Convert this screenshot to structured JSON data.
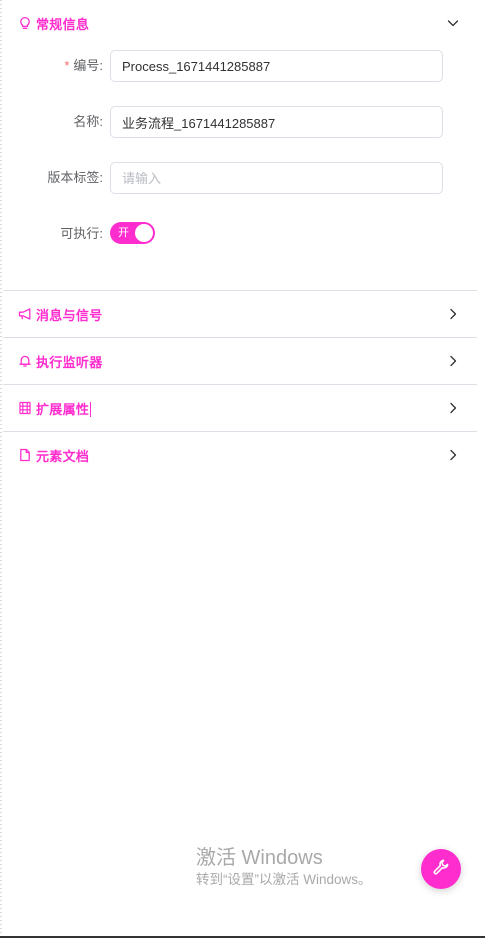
{
  "theme": {
    "accent": "#ff2dce",
    "required_star": "#f56c6c",
    "border": "#dcdfe6"
  },
  "general_section": {
    "title": "常规信息",
    "icon": "lightbulb-icon",
    "expanded": true,
    "fields": {
      "id": {
        "required_mark": "*",
        "label": "编号:",
        "value": "Process_1671441285887"
      },
      "name": {
        "label": "名称:",
        "value": "业务流程_1671441285887"
      },
      "version_tag": {
        "label": "版本标签:",
        "value": "",
        "placeholder": "请输入"
      },
      "executable": {
        "label": "可执行:",
        "on": true,
        "switch_text": "开"
      }
    }
  },
  "sections": [
    {
      "title": "消息与信号",
      "icon": "megaphone-icon",
      "expanded": false
    },
    {
      "title": "执行监听器",
      "icon": "bell-icon",
      "expanded": false
    },
    {
      "title": "扩展属性",
      "icon": "grid-list-icon",
      "expanded": false
    },
    {
      "title": "元素文档",
      "icon": "document-icon",
      "expanded": false
    }
  ],
  "watermark": {
    "title": "激活 Windows",
    "subtitle": "转到“设置”以激活 Windows。"
  },
  "fab": {
    "icon": "wrench-icon"
  }
}
